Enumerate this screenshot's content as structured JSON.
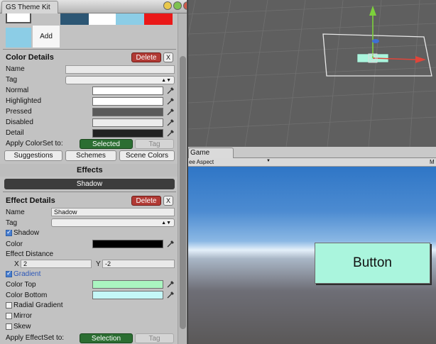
{
  "window": {
    "tab_title": "GS Theme Kit"
  },
  "swatches": {
    "colors": [
      "#ffffff",
      "#2c5674",
      "#ffffff",
      "#8ccde6",
      "#ea1818",
      "#8ccde6"
    ],
    "add_label": "Add"
  },
  "color_details": {
    "header": "Color Details",
    "delete_label": "Delete",
    "close_label": "X",
    "name_label": "Name",
    "name_value": "",
    "tag_label": "Tag",
    "tag_value": "",
    "rows": [
      {
        "label": "Normal",
        "color": "#ffffff"
      },
      {
        "label": "Highlighted",
        "color": "#ffffff"
      },
      {
        "label": "Pressed",
        "color": "#5a5a5a"
      },
      {
        "label": "Disabled",
        "color": "#ebebeb"
      },
      {
        "label": "Detail",
        "color": "#222222"
      }
    ],
    "apply_label": "Apply ColorSet to:",
    "selected_label": "Selected",
    "tag_button_label": "Tag",
    "suggestions_label": "Suggestions",
    "schemes_label": "Schemes",
    "scene_colors_label": "Scene Colors"
  },
  "effects": {
    "header": "Effects",
    "shadow_bar_label": "Shadow"
  },
  "effect_details": {
    "header": "Effect Details",
    "delete_label": "Delete",
    "close_label": "X",
    "name_label": "Name",
    "name_value": "Shadow",
    "tag_label": "Tag",
    "tag_value": "",
    "shadow_check_label": "Shadow",
    "shadow_checked": true,
    "color_label": "Color",
    "color_value": "#000000",
    "distance_label": "Effect Distance",
    "x_label": "X",
    "x_value": "2",
    "y_label": "Y",
    "y_value": "-2",
    "gradient_label": "Gradient",
    "gradient_checked": true,
    "color_top_label": "Color Top",
    "color_top": "#aaf5c0",
    "color_bottom_label": "Color Bottom",
    "color_bottom": "#c4f7f7",
    "radial_label": "Radial Gradient",
    "mirror_label": "Mirror",
    "skew_label": "Skew",
    "apply_label": "Apply EffectSet to:",
    "selection_label": "Selection",
    "tag_button_label": "Tag"
  },
  "game_view": {
    "tab_label": "Game",
    "aspect_label": "ee Aspect",
    "right_label": "M",
    "button_label": "Button"
  },
  "colors": {
    "delete": "#b13a35",
    "green": "#2b6e32",
    "scene_bg": "#5f5f5f",
    "button_fill": "#aaf5dd"
  },
  "icons": [
    "eyedropper-icon",
    "caret-down-icon",
    "checkbox-icon",
    "move-gizmo-icon",
    "window-control-icon"
  ]
}
